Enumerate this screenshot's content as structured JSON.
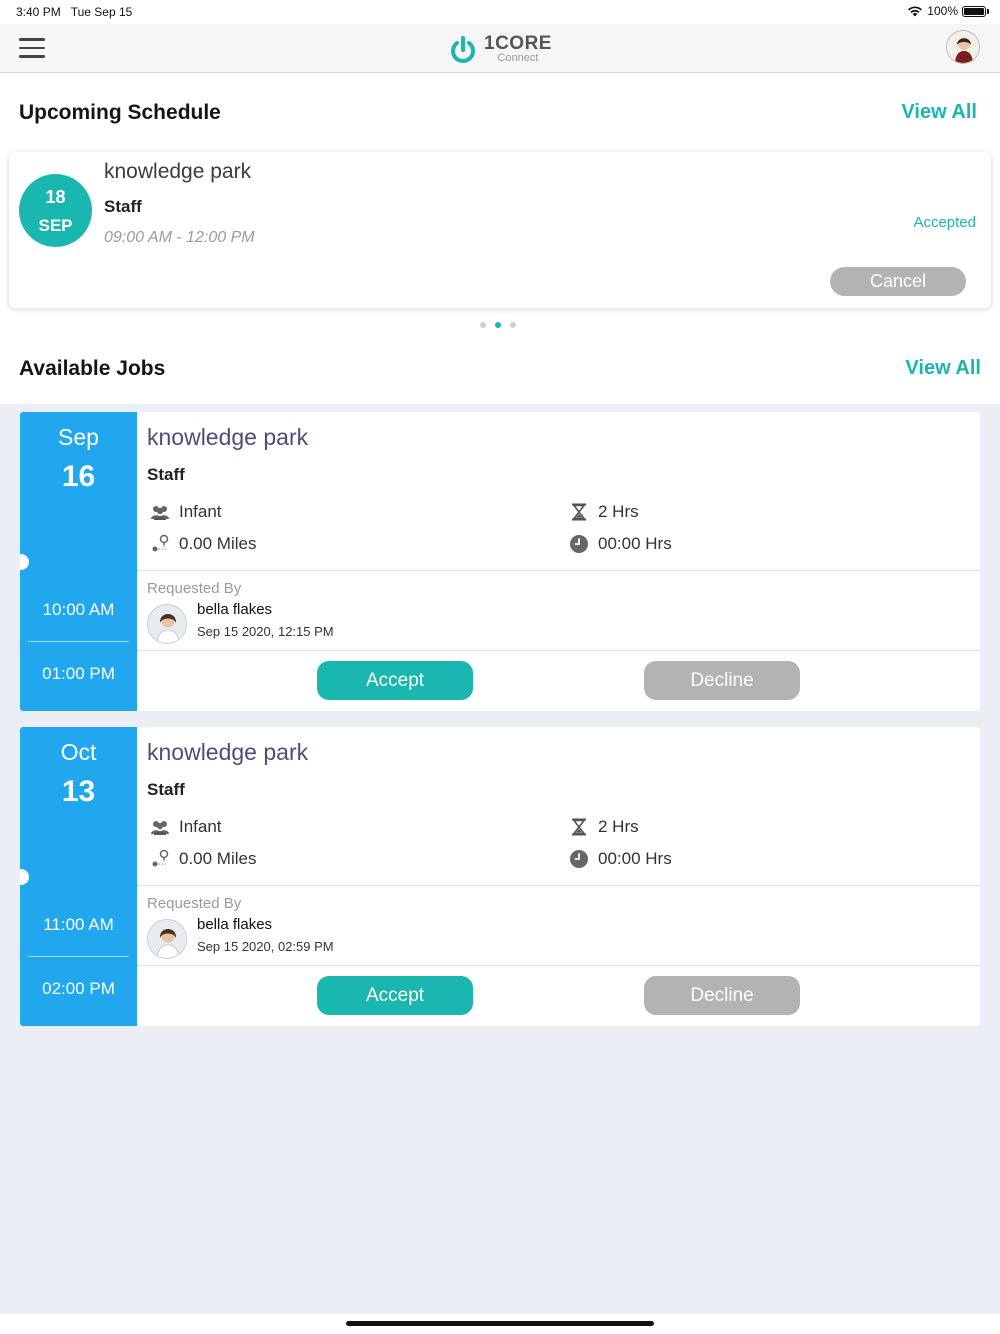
{
  "status_bar": {
    "time": "3:40 PM",
    "date": "Tue Sep 15",
    "battery": "100%"
  },
  "nav": {
    "logo_brand": "1CORE",
    "logo_sub": "Connect"
  },
  "schedule": {
    "title": "Upcoming Schedule",
    "view_all": "View All",
    "card": {
      "day": "18",
      "month": "SEP",
      "place": "knowledge park",
      "role": "Staff",
      "time": "09:00 AM - 12:00 PM",
      "status": "Accepted",
      "cancel_label": "Cancel"
    },
    "pager": {
      "count": 3,
      "active": 2
    }
  },
  "jobs": {
    "title": "Available Jobs",
    "view_all": "View All",
    "items": [
      {
        "month": "Sep",
        "day": "16",
        "start": "10:00 AM",
        "end": "01:00 PM",
        "place": "knowledge park",
        "role": "Staff",
        "age_group": "Infant",
        "distance": "0.00 Miles",
        "duration": "2 Hrs",
        "elapsed": "00:00 Hrs",
        "requested_by_label": "Requested By",
        "requester": "bella flakes",
        "requested_at": "Sep 15 2020, 12:15 PM",
        "accept_label": "Accept",
        "decline_label": "Decline"
      },
      {
        "month": "Oct",
        "day": "13",
        "start": "11:00 AM",
        "end": "02:00 PM",
        "place": "knowledge park",
        "role": "Staff",
        "age_group": "Infant",
        "distance": "0.00 Miles",
        "duration": "2 Hrs",
        "elapsed": "00:00 Hrs",
        "requested_by_label": "Requested By",
        "requester": "bella flakes",
        "requested_at": "Sep 15 2020, 02:59 PM",
        "accept_label": "Accept",
        "decline_label": "Decline"
      }
    ]
  },
  "colors": {
    "accent": "#19b7b0",
    "job_date_panel": "#21a7ee",
    "title_text": "#4c4e78",
    "button_gray": "#b3b3b3"
  }
}
